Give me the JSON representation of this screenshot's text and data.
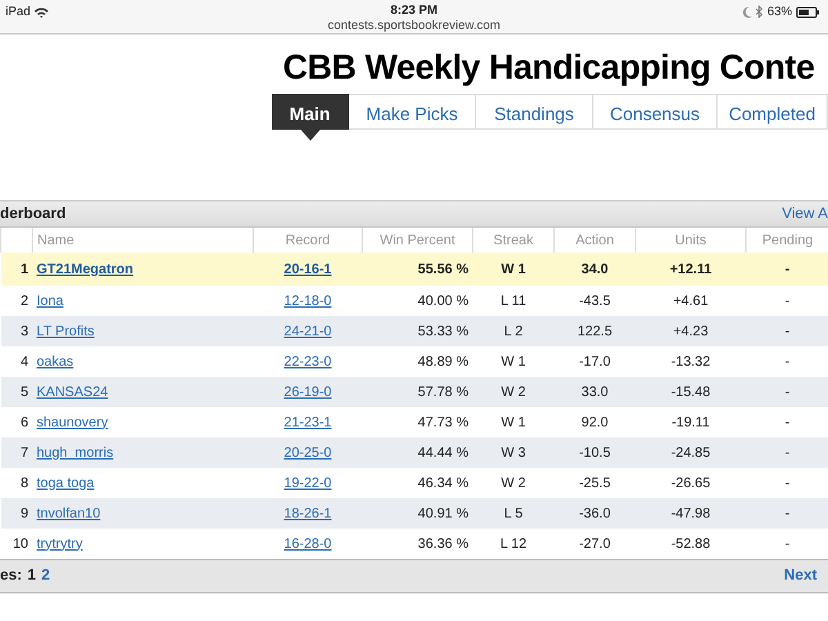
{
  "status_bar": {
    "device": "iPad",
    "time": "8:23 PM",
    "url": "contests.sportsbookreview.com",
    "battery": "63%"
  },
  "title": "CBB Weekly Handicapping Conte",
  "tabs": [
    {
      "label": "Main",
      "selected": true
    },
    {
      "label": "Make Picks",
      "selected": false
    },
    {
      "label": "Standings",
      "selected": false
    },
    {
      "label": "Consensus",
      "selected": false
    },
    {
      "label": "Completed",
      "selected": false
    }
  ],
  "leaderboard": {
    "title": "derboard",
    "view_all": "View A",
    "columns": [
      "Name",
      "Record",
      "Win Percent",
      "Streak",
      "Action",
      "Units",
      "Pending"
    ],
    "rows": [
      {
        "rank": "1",
        "name": "GT21Megatron",
        "record": "20-16-1",
        "win_percent": "55.56 %",
        "streak": "W 1",
        "action": "34.0",
        "units": "+12.11",
        "pending": "-",
        "highlighted": true
      },
      {
        "rank": "2",
        "name": "Iona",
        "record": "12-18-0",
        "win_percent": "40.00 %",
        "streak": "L 11",
        "action": "-43.5",
        "units": "+4.61",
        "pending": "-",
        "highlighted": false
      },
      {
        "rank": "3",
        "name": "LT Profits",
        "record": "24-21-0",
        "win_percent": "53.33 %",
        "streak": "L 2",
        "action": "122.5",
        "units": "+4.23",
        "pending": "-",
        "highlighted": false
      },
      {
        "rank": "4",
        "name": "oakas",
        "record": "22-23-0",
        "win_percent": "48.89 %",
        "streak": "W 1",
        "action": "-17.0",
        "units": "-13.32",
        "pending": "-",
        "highlighted": false
      },
      {
        "rank": "5",
        "name": "KANSAS24",
        "record": "26-19-0",
        "win_percent": "57.78 %",
        "streak": "W 2",
        "action": "33.0",
        "units": "-15.48",
        "pending": "-",
        "highlighted": false
      },
      {
        "rank": "6",
        "name": "shaunovery",
        "record": "21-23-1",
        "win_percent": "47.73 %",
        "streak": "W 1",
        "action": "92.0",
        "units": "-19.11",
        "pending": "-",
        "highlighted": false
      },
      {
        "rank": "7",
        "name": "hugh_morris",
        "record": "20-25-0",
        "win_percent": "44.44 %",
        "streak": "W 3",
        "action": "-10.5",
        "units": "-24.85",
        "pending": "-",
        "highlighted": false
      },
      {
        "rank": "8",
        "name": "toga toga",
        "record": "19-22-0",
        "win_percent": "46.34 %",
        "streak": "W 2",
        "action": "-25.5",
        "units": "-26.65",
        "pending": "-",
        "highlighted": false
      },
      {
        "rank": "9",
        "name": "tnvolfan10",
        "record": "18-26-1",
        "win_percent": "40.91 %",
        "streak": "L 5",
        "action": "-36.0",
        "units": "-47.98",
        "pending": "-",
        "highlighted": false
      },
      {
        "rank": "10",
        "name": "trytrytry",
        "record": "16-28-0",
        "win_percent": "36.36 %",
        "streak": "L 12",
        "action": "-27.0",
        "units": "-52.88",
        "pending": "-",
        "highlighted": false
      }
    ],
    "pages_label": "es:",
    "pages": [
      {
        "label": "1",
        "selected": true
      },
      {
        "label": "2",
        "selected": false
      }
    ],
    "next": "Next"
  }
}
